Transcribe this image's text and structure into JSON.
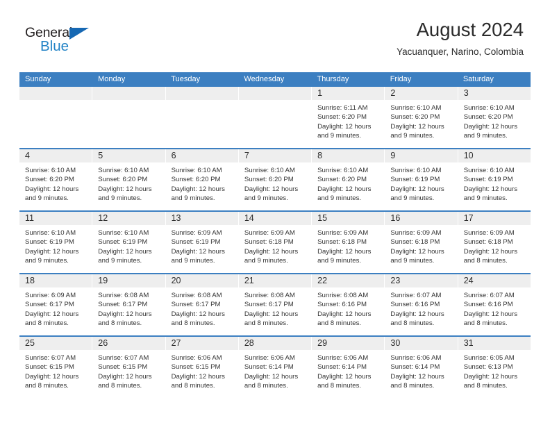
{
  "brand": {
    "name_top": "General",
    "name_bottom": "Blue",
    "triangle_icon": "blue-triangle-logo-mark",
    "color_dark": "#231f20",
    "color_blue": "#2283c6"
  },
  "header": {
    "title": "August 2024",
    "subtitle": "Yacuanquer, Narino, Colombia"
  },
  "theme": {
    "header_bg": "#3c7fc1",
    "header_text": "#ffffff",
    "daynum_band_bg": "#eeeeee",
    "separator": "#3c7fc1",
    "body_text": "#333333"
  },
  "weekdays": [
    "Sunday",
    "Monday",
    "Tuesday",
    "Wednesday",
    "Thursday",
    "Friday",
    "Saturday"
  ],
  "weeks": [
    [
      {
        "day": "",
        "lines": []
      },
      {
        "day": "",
        "lines": []
      },
      {
        "day": "",
        "lines": []
      },
      {
        "day": "",
        "lines": []
      },
      {
        "day": "1",
        "lines": [
          "Sunrise: 6:11 AM",
          "Sunset: 6:20 PM",
          "Daylight: 12 hours",
          "and 9 minutes."
        ]
      },
      {
        "day": "2",
        "lines": [
          "Sunrise: 6:10 AM",
          "Sunset: 6:20 PM",
          "Daylight: 12 hours",
          "and 9 minutes."
        ]
      },
      {
        "day": "3",
        "lines": [
          "Sunrise: 6:10 AM",
          "Sunset: 6:20 PM",
          "Daylight: 12 hours",
          "and 9 minutes."
        ]
      }
    ],
    [
      {
        "day": "4",
        "lines": [
          "Sunrise: 6:10 AM",
          "Sunset: 6:20 PM",
          "Daylight: 12 hours",
          "and 9 minutes."
        ]
      },
      {
        "day": "5",
        "lines": [
          "Sunrise: 6:10 AM",
          "Sunset: 6:20 PM",
          "Daylight: 12 hours",
          "and 9 minutes."
        ]
      },
      {
        "day": "6",
        "lines": [
          "Sunrise: 6:10 AM",
          "Sunset: 6:20 PM",
          "Daylight: 12 hours",
          "and 9 minutes."
        ]
      },
      {
        "day": "7",
        "lines": [
          "Sunrise: 6:10 AM",
          "Sunset: 6:20 PM",
          "Daylight: 12 hours",
          "and 9 minutes."
        ]
      },
      {
        "day": "8",
        "lines": [
          "Sunrise: 6:10 AM",
          "Sunset: 6:20 PM",
          "Daylight: 12 hours",
          "and 9 minutes."
        ]
      },
      {
        "day": "9",
        "lines": [
          "Sunrise: 6:10 AM",
          "Sunset: 6:19 PM",
          "Daylight: 12 hours",
          "and 9 minutes."
        ]
      },
      {
        "day": "10",
        "lines": [
          "Sunrise: 6:10 AM",
          "Sunset: 6:19 PM",
          "Daylight: 12 hours",
          "and 9 minutes."
        ]
      }
    ],
    [
      {
        "day": "11",
        "lines": [
          "Sunrise: 6:10 AM",
          "Sunset: 6:19 PM",
          "Daylight: 12 hours",
          "and 9 minutes."
        ]
      },
      {
        "day": "12",
        "lines": [
          "Sunrise: 6:10 AM",
          "Sunset: 6:19 PM",
          "Daylight: 12 hours",
          "and 9 minutes."
        ]
      },
      {
        "day": "13",
        "lines": [
          "Sunrise: 6:09 AM",
          "Sunset: 6:19 PM",
          "Daylight: 12 hours",
          "and 9 minutes."
        ]
      },
      {
        "day": "14",
        "lines": [
          "Sunrise: 6:09 AM",
          "Sunset: 6:18 PM",
          "Daylight: 12 hours",
          "and 9 minutes."
        ]
      },
      {
        "day": "15",
        "lines": [
          "Sunrise: 6:09 AM",
          "Sunset: 6:18 PM",
          "Daylight: 12 hours",
          "and 9 minutes."
        ]
      },
      {
        "day": "16",
        "lines": [
          "Sunrise: 6:09 AM",
          "Sunset: 6:18 PM",
          "Daylight: 12 hours",
          "and 9 minutes."
        ]
      },
      {
        "day": "17",
        "lines": [
          "Sunrise: 6:09 AM",
          "Sunset: 6:18 PM",
          "Daylight: 12 hours",
          "and 8 minutes."
        ]
      }
    ],
    [
      {
        "day": "18",
        "lines": [
          "Sunrise: 6:09 AM",
          "Sunset: 6:17 PM",
          "Daylight: 12 hours",
          "and 8 minutes."
        ]
      },
      {
        "day": "19",
        "lines": [
          "Sunrise: 6:08 AM",
          "Sunset: 6:17 PM",
          "Daylight: 12 hours",
          "and 8 minutes."
        ]
      },
      {
        "day": "20",
        "lines": [
          "Sunrise: 6:08 AM",
          "Sunset: 6:17 PM",
          "Daylight: 12 hours",
          "and 8 minutes."
        ]
      },
      {
        "day": "21",
        "lines": [
          "Sunrise: 6:08 AM",
          "Sunset: 6:17 PM",
          "Daylight: 12 hours",
          "and 8 minutes."
        ]
      },
      {
        "day": "22",
        "lines": [
          "Sunrise: 6:08 AM",
          "Sunset: 6:16 PM",
          "Daylight: 12 hours",
          "and 8 minutes."
        ]
      },
      {
        "day": "23",
        "lines": [
          "Sunrise: 6:07 AM",
          "Sunset: 6:16 PM",
          "Daylight: 12 hours",
          "and 8 minutes."
        ]
      },
      {
        "day": "24",
        "lines": [
          "Sunrise: 6:07 AM",
          "Sunset: 6:16 PM",
          "Daylight: 12 hours",
          "and 8 minutes."
        ]
      }
    ],
    [
      {
        "day": "25",
        "lines": [
          "Sunrise: 6:07 AM",
          "Sunset: 6:15 PM",
          "Daylight: 12 hours",
          "and 8 minutes."
        ]
      },
      {
        "day": "26",
        "lines": [
          "Sunrise: 6:07 AM",
          "Sunset: 6:15 PM",
          "Daylight: 12 hours",
          "and 8 minutes."
        ]
      },
      {
        "day": "27",
        "lines": [
          "Sunrise: 6:06 AM",
          "Sunset: 6:15 PM",
          "Daylight: 12 hours",
          "and 8 minutes."
        ]
      },
      {
        "day": "28",
        "lines": [
          "Sunrise: 6:06 AM",
          "Sunset: 6:14 PM",
          "Daylight: 12 hours",
          "and 8 minutes."
        ]
      },
      {
        "day": "29",
        "lines": [
          "Sunrise: 6:06 AM",
          "Sunset: 6:14 PM",
          "Daylight: 12 hours",
          "and 8 minutes."
        ]
      },
      {
        "day": "30",
        "lines": [
          "Sunrise: 6:06 AM",
          "Sunset: 6:14 PM",
          "Daylight: 12 hours",
          "and 8 minutes."
        ]
      },
      {
        "day": "31",
        "lines": [
          "Sunrise: 6:05 AM",
          "Sunset: 6:13 PM",
          "Daylight: 12 hours",
          "and 8 minutes."
        ]
      }
    ]
  ]
}
